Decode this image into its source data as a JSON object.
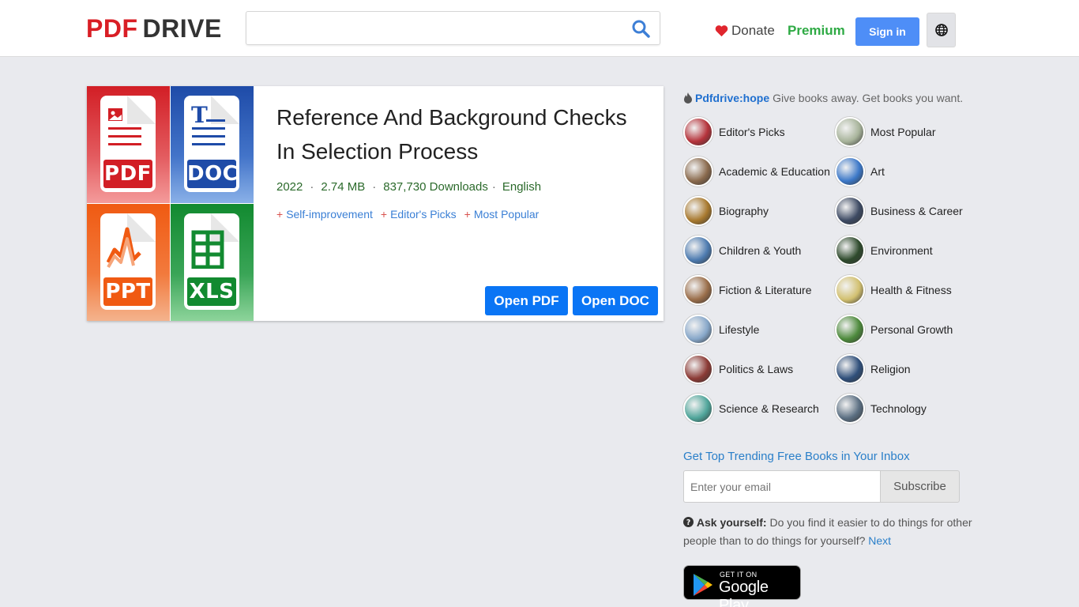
{
  "header": {
    "logo_pdf": "PDF",
    "logo_drive": "DRIVE",
    "search_placeholder": "",
    "donate_label": "Donate",
    "premium_label": "Premium",
    "signin_label": "Sign in"
  },
  "book": {
    "title": "Reference And Background Checks In Selection Process",
    "year": "2022",
    "size": "2.74 MB",
    "downloads": "837,730 Downloads",
    "language": "English",
    "tags": [
      "Self-improvement",
      "Editor's Picks",
      "Most Popular"
    ],
    "cover_labels": [
      "PDF",
      "DOC",
      "PPT",
      "XLS"
    ],
    "open_pdf_label": "Open PDF",
    "open_doc_label": "Open DOC"
  },
  "sidebar": {
    "hope_handle": "Pdfdrive:hope",
    "hope_text": "Give books away. Get books you want.",
    "categories": [
      {
        "label": "Editor's Picks",
        "color": "#b5333b"
      },
      {
        "label": "Most Popular",
        "color": "#a7b39a"
      },
      {
        "label": "Academic & Education",
        "color": "#8a6a4d"
      },
      {
        "label": "Art",
        "color": "#3c78c8"
      },
      {
        "label": "Biography",
        "color": "#a8792e"
      },
      {
        "label": "Business & Career",
        "color": "#3d4a63"
      },
      {
        "label": "Children & Youth",
        "color": "#4d7bb0"
      },
      {
        "label": "Environment",
        "color": "#2e4a2c"
      },
      {
        "label": "Fiction & Literature",
        "color": "#9a6e4a"
      },
      {
        "label": "Health & Fitness",
        "color": "#d2c070"
      },
      {
        "label": "Lifestyle",
        "color": "#87a7c9"
      },
      {
        "label": "Personal Growth",
        "color": "#4d8a3c"
      },
      {
        "label": "Politics & Laws",
        "color": "#8b3a35"
      },
      {
        "label": "Religion",
        "color": "#2f4f7a"
      },
      {
        "label": "Science & Research",
        "color": "#4fa59a"
      },
      {
        "label": "Technology",
        "color": "#5b6f82"
      }
    ],
    "newsletter_title": "Get Top Trending Free Books in Your Inbox",
    "email_placeholder": "Enter your email",
    "subscribe_label": "Subscribe",
    "ask_label": "Ask yourself:",
    "ask_text": "Do you find it easier to do things for other people than to do things for yourself?",
    "ask_next": "Next",
    "gplay_small": "GET IT ON",
    "gplay_big": "Google Play"
  }
}
